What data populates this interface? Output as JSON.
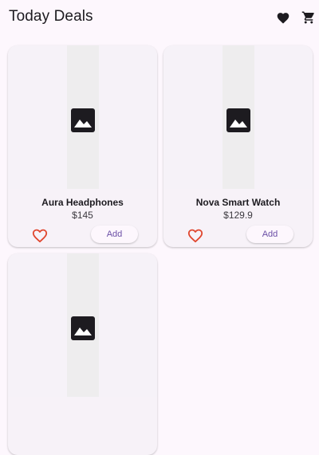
{
  "appbar": {
    "title": "Today Deals",
    "icons": [
      "favorite-icon",
      "shopping-cart-icon"
    ]
  },
  "products": [
    {
      "name": "Aura Headphones",
      "price": "$145",
      "add_label": "Add",
      "image_icon": "image-placeholder-icon",
      "liked": false
    },
    {
      "name": "Nova Smart Watch",
      "price": "$129.9",
      "add_label": "Add",
      "image_icon": "image-placeholder-icon",
      "liked": false
    },
    {
      "name": "",
      "price": "",
      "add_label": "",
      "image_icon": "image-placeholder-icon",
      "liked": false
    }
  ],
  "colors": {
    "background": "#fdf7fd",
    "card": "#f7f2f8",
    "accent": "#6b4fa6",
    "like": "#e0472f",
    "icon": "#1d1b20"
  }
}
